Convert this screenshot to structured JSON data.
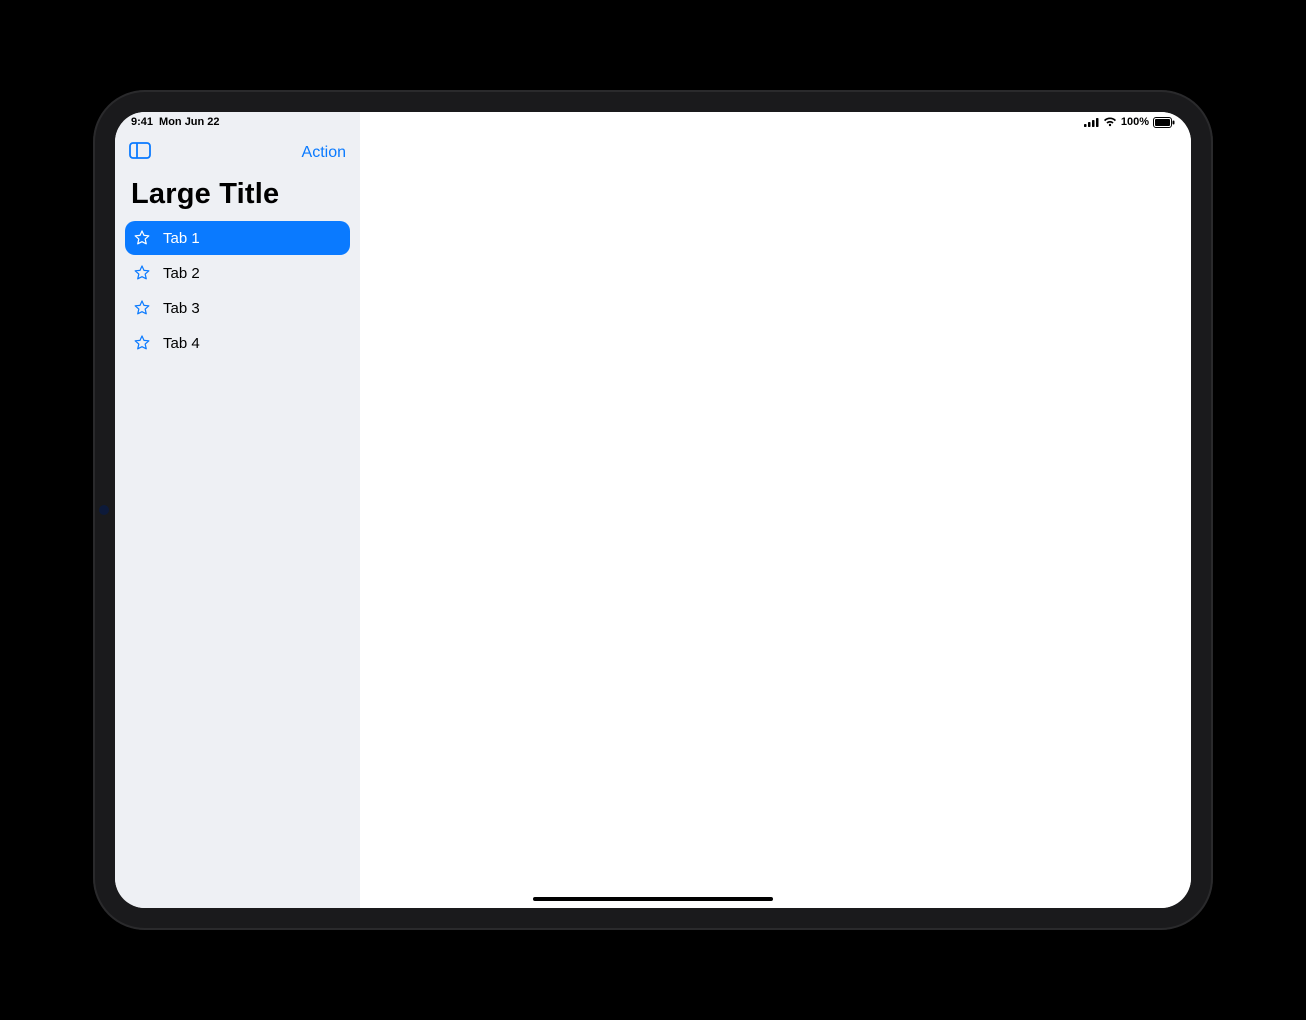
{
  "status": {
    "time": "9:41",
    "date": "Mon Jun 22",
    "battery_pct": "100%"
  },
  "nav": {
    "action_label": "Action"
  },
  "sidebar": {
    "large_title": "Large Title",
    "items": [
      {
        "label": "Tab 1",
        "selected": true
      },
      {
        "label": "Tab 2",
        "selected": false
      },
      {
        "label": "Tab 3",
        "selected": false
      },
      {
        "label": "Tab 4",
        "selected": false
      }
    ]
  },
  "colors": {
    "accent": "#0a7aff",
    "sidebar_bg": "#eef0f4"
  }
}
